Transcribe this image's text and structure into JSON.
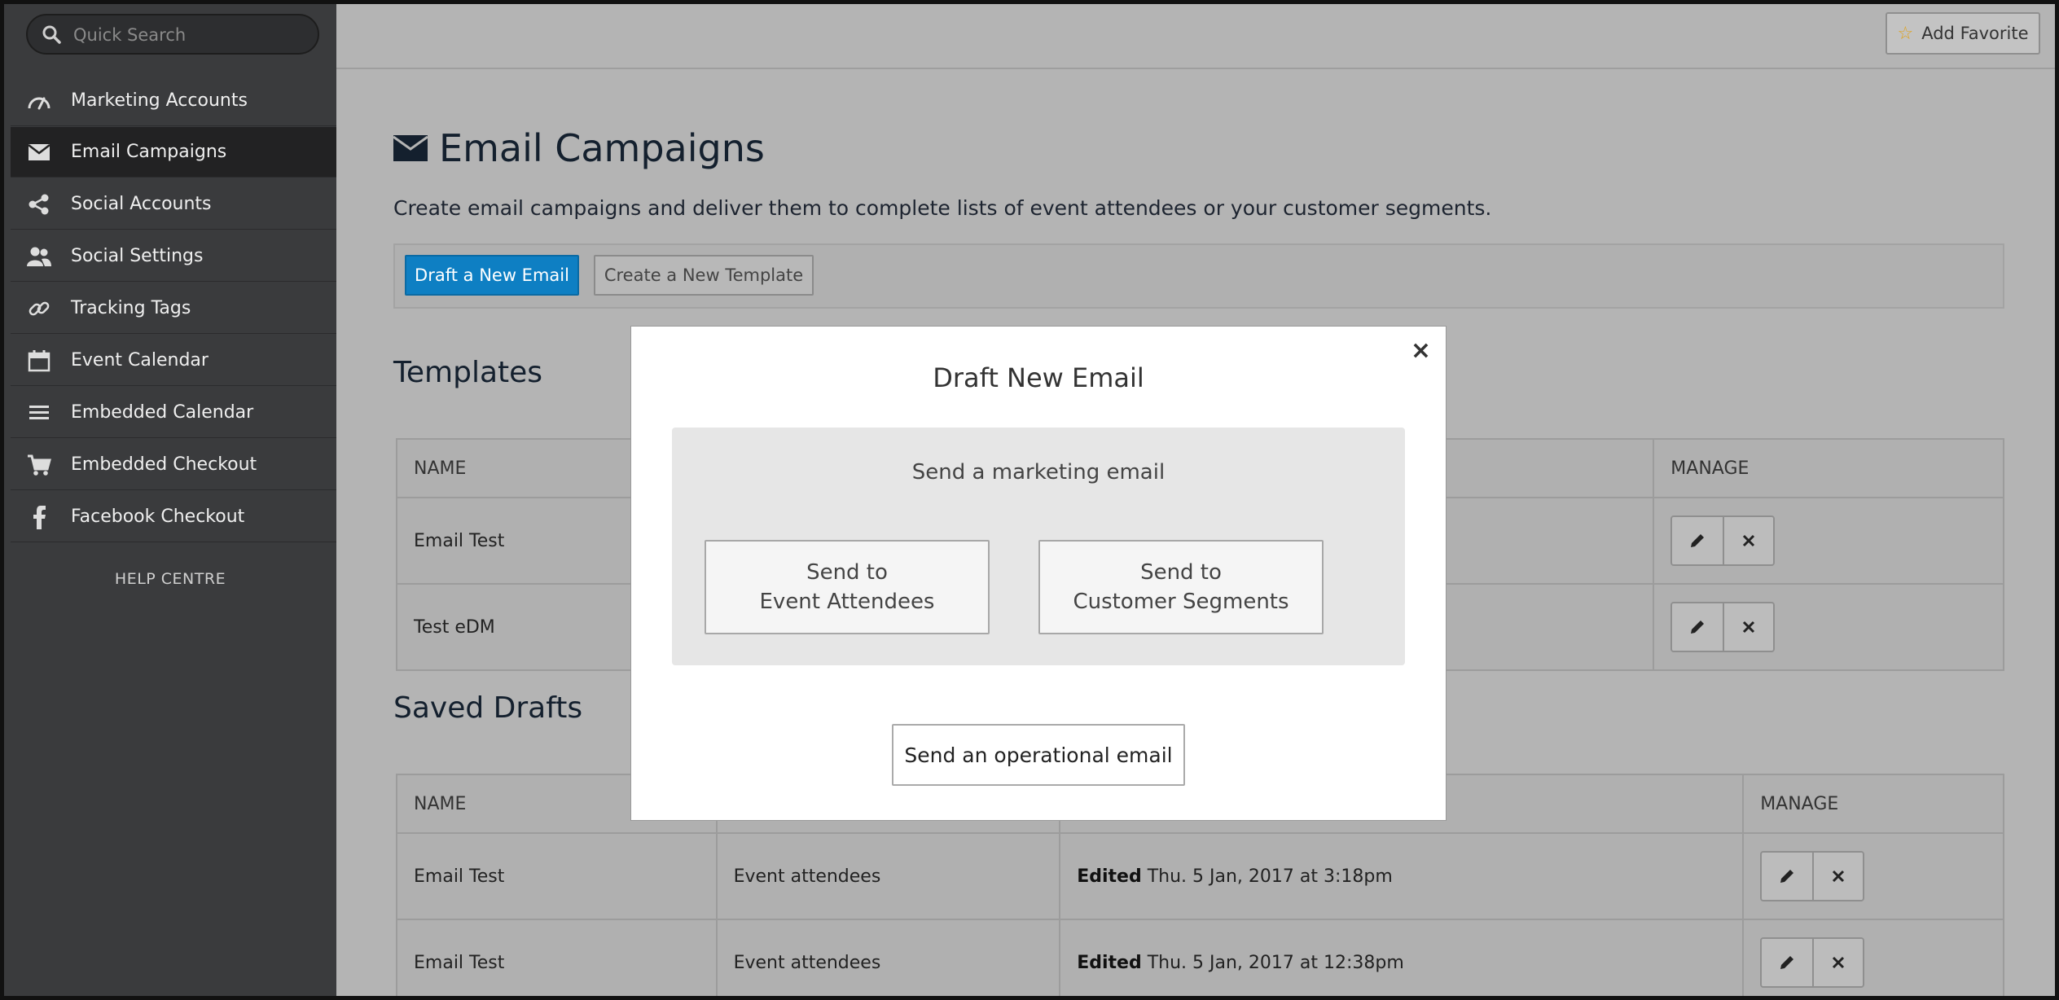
{
  "search": {
    "placeholder": "Quick Search"
  },
  "sidebar": {
    "items": [
      {
        "label": "Marketing Accounts",
        "icon": "speedometer-icon"
      },
      {
        "label": "Email Campaigns",
        "icon": "envelope-icon",
        "active": true
      },
      {
        "label": "Social Accounts",
        "icon": "share-icon"
      },
      {
        "label": "Social Settings",
        "icon": "users-icon"
      },
      {
        "label": "Tracking Tags",
        "icon": "link-icon"
      },
      {
        "label": "Event Calendar",
        "icon": "calendar-icon"
      },
      {
        "label": "Embedded Calendar",
        "icon": "list-icon"
      },
      {
        "label": "Embedded Checkout",
        "icon": "cart-icon"
      },
      {
        "label": "Facebook Checkout",
        "icon": "facebook-icon"
      }
    ],
    "help": "HELP CENTRE"
  },
  "topbar": {
    "add_favorite": "Add Favorite"
  },
  "page": {
    "title": "Email Campaigns",
    "subtitle": "Create email campaigns and deliver them to complete lists of event attendees or your customer segments.",
    "draft_button": "Draft a New Email",
    "template_button": "Create a New Template"
  },
  "templates": {
    "title": "Templates",
    "headers": {
      "name": "NAME",
      "manage": "MANAGE"
    },
    "rows": [
      {
        "name": "Email Test"
      },
      {
        "name": "Test eDM"
      }
    ]
  },
  "drafts": {
    "title": "Saved Drafts",
    "headers": {
      "name": "NAME",
      "manage": "MANAGE"
    },
    "rows": [
      {
        "name": "Email Test",
        "audience": "Event attendees",
        "edited_label": "Edited",
        "edited_date": "Thu. 5 Jan, 2017 at 3:18pm"
      },
      {
        "name": "Email Test",
        "audience": "Event attendees",
        "edited_label": "Edited",
        "edited_date": "Thu. 5 Jan, 2017 at 12:38pm"
      }
    ]
  },
  "modal": {
    "title": "Draft New Email",
    "close": "×",
    "marketing_title": "Send a marketing email",
    "attendees_line1": "Send to",
    "attendees_line2": "Event Attendees",
    "segments_line1": "Send to",
    "segments_line2": "Customer Segments",
    "operational": "Send an operational email"
  },
  "colors": {
    "primary": "#0e7fc3",
    "sidebar": "#3a3b3d",
    "star": "#e0a21a"
  }
}
